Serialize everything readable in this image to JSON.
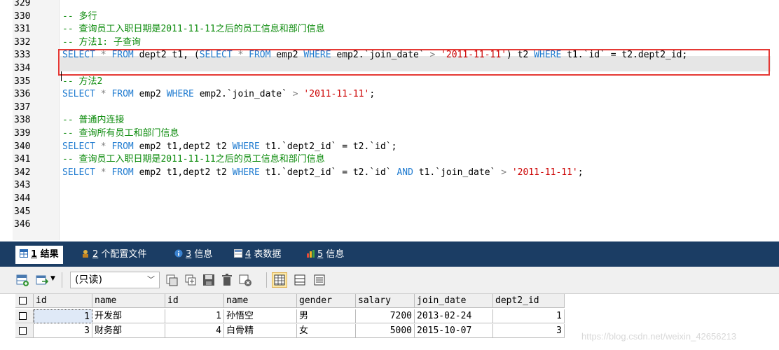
{
  "editor": {
    "lines": [
      {
        "n": "329",
        "code": []
      },
      {
        "n": "330",
        "code": [
          {
            "t": "-- 多行",
            "c": "cm"
          }
        ]
      },
      {
        "n": "331",
        "code": [
          {
            "t": "-- 查询员工入职日期是2011-11-11之后的员工信息和部门信息",
            "c": "cm"
          }
        ]
      },
      {
        "n": "332",
        "code": [
          {
            "t": "-- 方法1: 子查询",
            "c": "cm"
          }
        ]
      },
      {
        "n": "333",
        "code": [
          {
            "t": "SELECT",
            "c": "kw"
          },
          {
            "t": " ",
            "c": "plain"
          },
          {
            "t": "*",
            "c": "op"
          },
          {
            "t": " ",
            "c": "plain"
          },
          {
            "t": "FROM",
            "c": "kw"
          },
          {
            "t": " dept2 t1, (",
            "c": "plain"
          },
          {
            "t": "SELECT",
            "c": "kw"
          },
          {
            "t": " ",
            "c": "plain"
          },
          {
            "t": "*",
            "c": "op"
          },
          {
            "t": " ",
            "c": "plain"
          },
          {
            "t": "FROM",
            "c": "kw"
          },
          {
            "t": " emp2 ",
            "c": "plain"
          },
          {
            "t": "WHERE",
            "c": "kw"
          },
          {
            "t": " emp2.`join_date` ",
            "c": "plain"
          },
          {
            "t": ">",
            "c": "op"
          },
          {
            "t": " ",
            "c": "plain"
          },
          {
            "t": "'2011-11-11'",
            "c": "str"
          },
          {
            "t": ") t2 ",
            "c": "plain"
          },
          {
            "t": "WHERE",
            "c": "kw"
          },
          {
            "t": " t1.`id` = t2.dept2_id;",
            "c": "plain"
          }
        ]
      },
      {
        "n": "334",
        "code": []
      },
      {
        "n": "335",
        "code": [
          {
            "t": "-- 方法2",
            "c": "cm"
          }
        ]
      },
      {
        "n": "336",
        "code": [
          {
            "t": "SELECT",
            "c": "kw"
          },
          {
            "t": " ",
            "c": "plain"
          },
          {
            "t": "*",
            "c": "op"
          },
          {
            "t": " ",
            "c": "plain"
          },
          {
            "t": "FROM",
            "c": "kw"
          },
          {
            "t": " emp2 ",
            "c": "plain"
          },
          {
            "t": "WHERE",
            "c": "kw"
          },
          {
            "t": " emp2.`join_date` ",
            "c": "plain"
          },
          {
            "t": ">",
            "c": "op"
          },
          {
            "t": " ",
            "c": "plain"
          },
          {
            "t": "'2011-11-11'",
            "c": "str"
          },
          {
            "t": ";",
            "c": "plain"
          }
        ]
      },
      {
        "n": "337",
        "code": []
      },
      {
        "n": "338",
        "code": [
          {
            "t": "-- 普通内连接",
            "c": "cm"
          }
        ]
      },
      {
        "n": "339",
        "code": [
          {
            "t": "-- 查询所有员工和部门信息",
            "c": "cm"
          }
        ]
      },
      {
        "n": "340",
        "code": [
          {
            "t": "SELECT",
            "c": "kw"
          },
          {
            "t": " ",
            "c": "plain"
          },
          {
            "t": "*",
            "c": "op"
          },
          {
            "t": " ",
            "c": "plain"
          },
          {
            "t": "FROM",
            "c": "kw"
          },
          {
            "t": " emp2 t1,dept2 t2 ",
            "c": "plain"
          },
          {
            "t": "WHERE",
            "c": "kw"
          },
          {
            "t": " t1.`dept2_id` = t2.`id`;",
            "c": "plain"
          }
        ]
      },
      {
        "n": "341",
        "code": [
          {
            "t": "-- 查询员工入职日期是2011-11-11之后的员工信息和部门信息",
            "c": "cm"
          }
        ]
      },
      {
        "n": "342",
        "code": [
          {
            "t": "SELECT",
            "c": "kw"
          },
          {
            "t": " ",
            "c": "plain"
          },
          {
            "t": "*",
            "c": "op"
          },
          {
            "t": " ",
            "c": "plain"
          },
          {
            "t": "FROM",
            "c": "kw"
          },
          {
            "t": " emp2 t1,dept2 t2 ",
            "c": "plain"
          },
          {
            "t": "WHERE",
            "c": "kw"
          },
          {
            "t": " t1.`dept2_id` = t2.`id` ",
            "c": "plain"
          },
          {
            "t": "AND",
            "c": "kw"
          },
          {
            "t": " t1.`join_date` ",
            "c": "plain"
          },
          {
            "t": ">",
            "c": "op"
          },
          {
            "t": " ",
            "c": "plain"
          },
          {
            "t": "'2011-11-11'",
            "c": "str"
          },
          {
            "t": ";",
            "c": "plain"
          }
        ]
      },
      {
        "n": "343",
        "code": []
      },
      {
        "n": "344",
        "code": []
      },
      {
        "n": "345",
        "code": []
      },
      {
        "n": "346",
        "code": []
      }
    ]
  },
  "tabs": [
    {
      "num": "1",
      "label": "结果",
      "active": true,
      "icon": "grid-result-icon"
    },
    {
      "num": "2",
      "label": "个配置文件",
      "active": false,
      "icon": "profile-icon"
    },
    {
      "num": "3",
      "label": "信息",
      "active": false,
      "icon": "info-icon"
    },
    {
      "num": "4",
      "label": "表数据",
      "active": false,
      "icon": "table-data-icon"
    },
    {
      "num": "5",
      "label": "信息",
      "active": false,
      "icon": "chart-info-icon"
    }
  ],
  "toolbar": {
    "readonly_label": "(只读)",
    "icons": [
      "add-row-icon",
      "export-icon",
      "save-icon",
      "copy-icon",
      "save-disk-icon",
      "delete-icon",
      "refresh-icon",
      "grid-view-icon",
      "form-view-icon",
      "text-view-icon"
    ]
  },
  "grid": {
    "columns": [
      "id",
      "name",
      "id",
      "name",
      "gender",
      "salary",
      "join_date",
      "dept2_id"
    ],
    "rows": [
      [
        "1",
        "开发部",
        "1",
        "孙悟空",
        "男",
        "7200",
        "2013-02-24",
        "1"
      ],
      [
        "3",
        "财务部",
        "4",
        "白骨精",
        "女",
        "5000",
        "2015-10-07",
        "3"
      ]
    ]
  },
  "watermark": "https://blog.csdn.net/weixin_42656213",
  "colors": {
    "keyword": "#1f7bd0",
    "comment": "#0a8a0a",
    "string": "#cc0000",
    "tabbar": "#1b3d64",
    "highlight_box": "#e53935"
  }
}
